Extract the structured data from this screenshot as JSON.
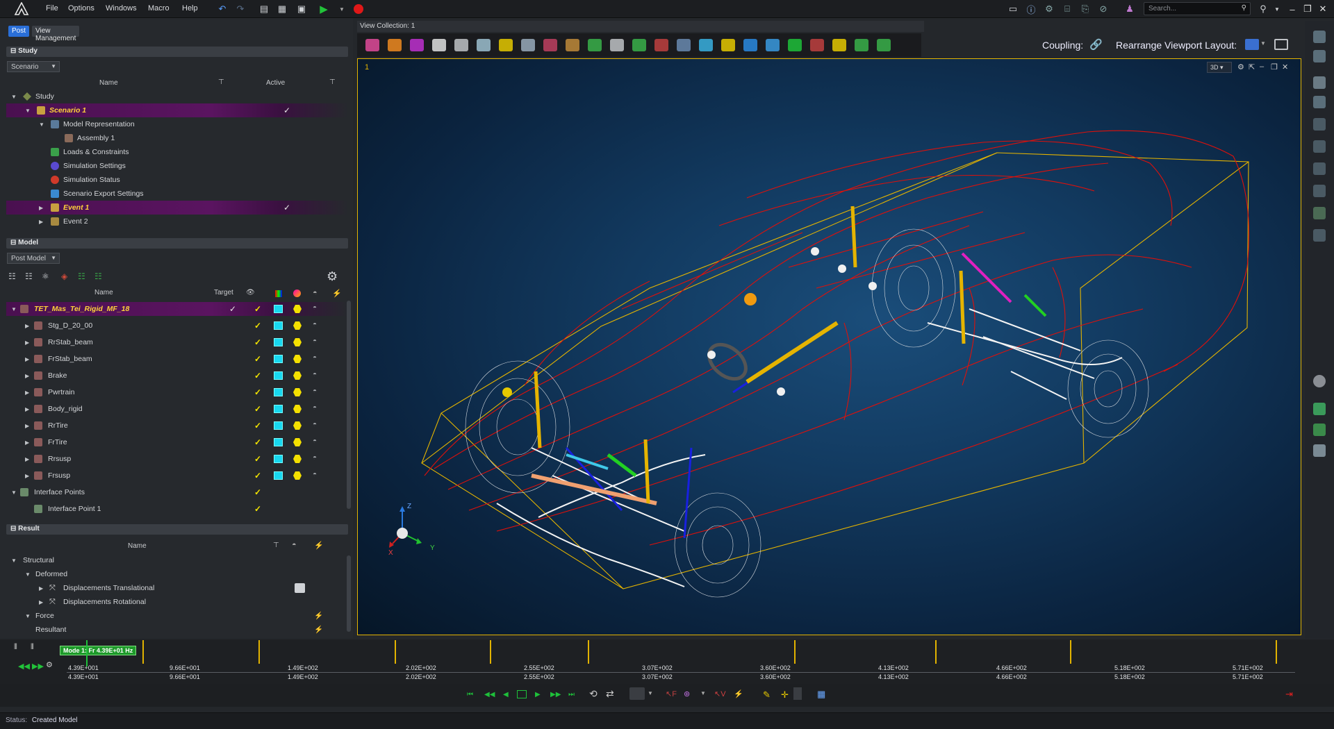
{
  "menu": {
    "items": [
      "File",
      "Options",
      "Windows",
      "Macro",
      "Help"
    ],
    "search_placeholder": "Search..."
  },
  "tabs": {
    "post": "Post",
    "view_management": "View Management"
  },
  "study": {
    "section_title": "Study",
    "dropdown": "Scenario",
    "col_name": "Name",
    "col_active": "Active",
    "rows": [
      {
        "label": "Study",
        "active": ""
      },
      {
        "label": "Scenario 1",
        "active": "✓"
      },
      {
        "label": "Model Representation",
        "active": ""
      },
      {
        "label": "Assembly 1",
        "active": ""
      },
      {
        "label": "Loads & Constraints",
        "active": ""
      },
      {
        "label": "Simulation Settings",
        "active": ""
      },
      {
        "label": "Simulation Status",
        "active": ""
      },
      {
        "label": "Scenario Export Settings",
        "active": ""
      },
      {
        "label": "Event 1",
        "active": "✓"
      },
      {
        "label": "Event 2",
        "active": ""
      }
    ]
  },
  "model": {
    "section_title": "Model",
    "dropdown": "Post Model",
    "col_name": "Name",
    "col_target": "Target",
    "rows": [
      "TET_Mas_Tei_Rigid_MF_18",
      "Stg_D_20_00",
      "RrStab_beam",
      "FrStab_beam",
      "Brake",
      "Pwrtrain",
      "Body_rigid",
      "RrTire",
      "FrTire",
      "Rrsusp",
      "Frsusp",
      "Interface Points",
      "Interface Point 1"
    ]
  },
  "result": {
    "section_title": "Result",
    "col_name": "Name",
    "rows": [
      "Structural",
      "Deformed",
      "Displacements Translational",
      "Displacements Rotational",
      "Force",
      "Resultant"
    ]
  },
  "viewport": {
    "collection_title": "View Collection: 1",
    "index": "1",
    "coupling_label": "Coupling:",
    "layout_label": "Rearrange Viewport Layout:",
    "mode_3d": "3D",
    "axis_x": "X",
    "axis_y": "Y",
    "axis_z": "Z"
  },
  "timeline": {
    "mode_label": "Mode 1: Fr 4.39E+01 Hz",
    "freqs": [
      "4.39E+001",
      "9.66E+001",
      "1.49E+002",
      "2.02E+002",
      "2.55E+002",
      "3.07E+002",
      "3.60E+002",
      "4.13E+002",
      "4.66E+002",
      "5.18E+002",
      "5.71E+002"
    ]
  },
  "status": {
    "label": "Status:",
    "text": "Created Model"
  },
  "colors": {
    "accent": "#e5b400",
    "highlight": "#5a1460",
    "wire_red": "#e0100a",
    "active_tab": "#2a6fd8"
  }
}
